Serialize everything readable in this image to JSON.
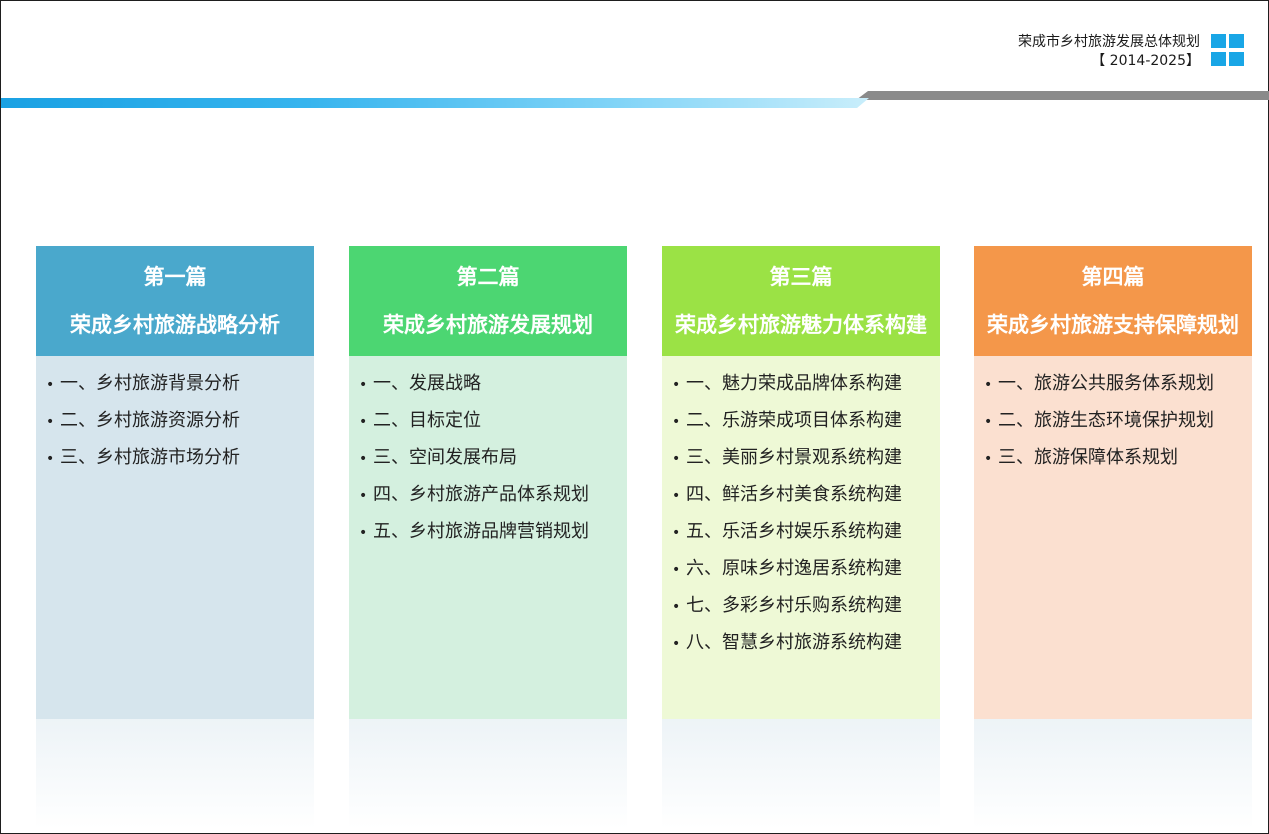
{
  "header": {
    "title": "荣成市乡村旅游发展总体规划",
    "period": "【 2014-2025】",
    "brand_color": "#19a6e6"
  },
  "columns": [
    {
      "part": "第一篇",
      "name": "荣成乡村旅游战略分析",
      "header_color": "#4aa8cc",
      "body_color": "#d6e5ed",
      "items": [
        "一、乡村旅游背景分析",
        "二、乡村旅游资源分析",
        "三、乡村旅游市场分析"
      ]
    },
    {
      "part": "第二篇",
      "name": "荣成乡村旅游发展规划",
      "header_color": "#4cd672",
      "body_color": "#d4f0df",
      "items": [
        "一、发展战略",
        "二、目标定位",
        "三、空间发展布局",
        "四、乡村旅游产品体系规划",
        "五、乡村旅游品牌营销规划"
      ]
    },
    {
      "part": "第三篇",
      "name": "荣成乡村旅游魅力体系构建",
      "header_color": "#9be245",
      "body_color": "#eef9d6",
      "items": [
        "一、魅力荣成品牌体系构建",
        "二、乐游荣成项目体系构建",
        "三、美丽乡村景观系统构建",
        "四、鲜活乡村美食系统构建",
        "五、乐活乡村娱乐系统构建",
        "六、原味乡村逸居系统构建",
        "七、多彩乡村乐购系统构建",
        "八、智慧乡村旅游系统构建"
      ]
    },
    {
      "part": "第四篇",
      "name": "荣成乡村旅游支持保障规划",
      "header_color": "#f4974a",
      "body_color": "#fbe0d0",
      "items": [
        "一、旅游公共服务体系规划",
        "二、旅游生态环境保护规划",
        "三、旅游保障体系规划"
      ]
    }
  ]
}
